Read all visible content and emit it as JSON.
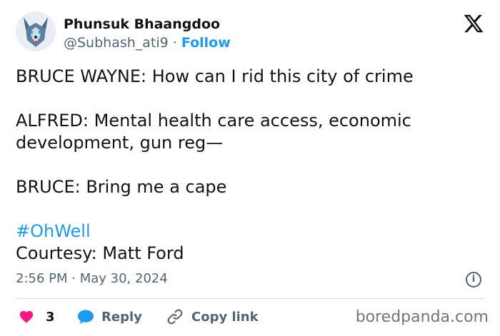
{
  "author": {
    "name": "Phunsuk Bhaangdoo",
    "handle": "@Subhash_ati9",
    "separator": " · ",
    "follow_label": "Follow"
  },
  "tweet": {
    "lines": [
      "BRUCE WAYNE: How can I rid this city of crime",
      "",
      "ALFRED: Mental health care access, economic development, gun reg—",
      "",
      "BRUCE: Bring me a cape",
      ""
    ],
    "hashtag": "#OhWell",
    "courtesy": "Courtesy: Matt Ford"
  },
  "meta": {
    "time": "2:56 PM",
    "separator": " · ",
    "date": "May 30, 2024"
  },
  "actions": {
    "like_count": "3",
    "reply_label": "Reply",
    "copy_label": "Copy link"
  },
  "watermark": "boredpanda.com",
  "colors": {
    "accent": "#1d9bf0",
    "like": "#f91880",
    "muted": "#536471"
  },
  "icons": [
    "x-logo-icon",
    "info-icon",
    "heart-icon",
    "reply-bubble-icon",
    "link-icon"
  ]
}
